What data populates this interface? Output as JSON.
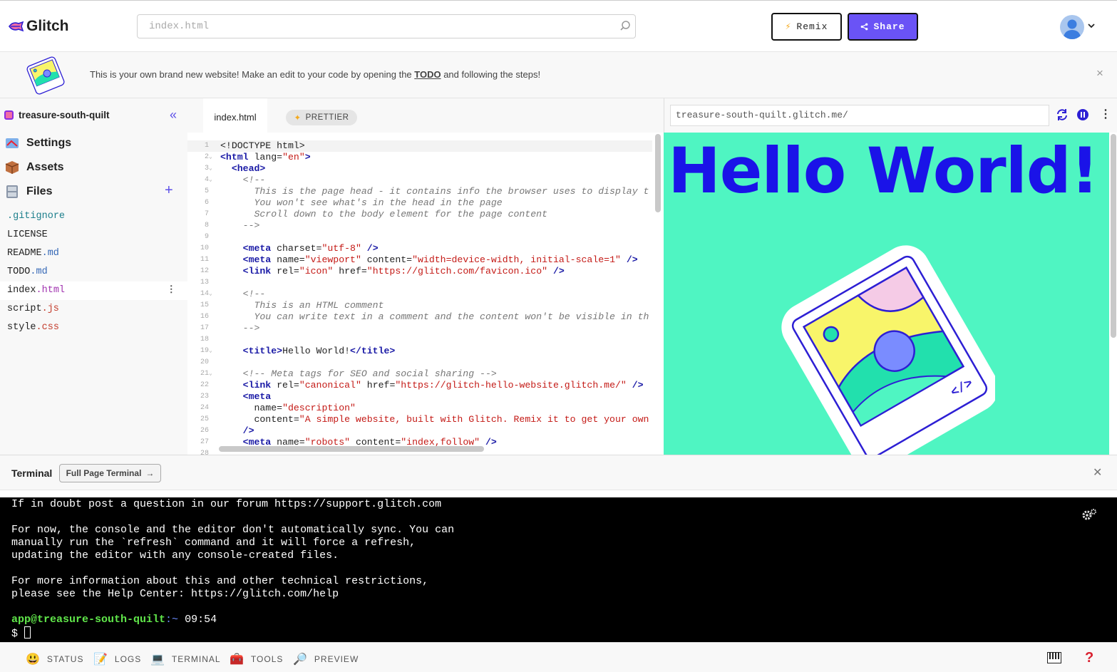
{
  "app": {
    "name": "Glitch"
  },
  "header": {
    "search_value": "index.html",
    "remix_label": "Remix",
    "share_label": "Share"
  },
  "banner": {
    "text_before": "This is your own brand new website! Make an edit to your code by opening the ",
    "link": "TODO",
    "text_after": " and following the steps!",
    "close": "×"
  },
  "sidebar": {
    "project_name": "treasure-south-quilt",
    "items": [
      {
        "label": "Settings",
        "icon": "settings-icon"
      },
      {
        "label": "Assets",
        "icon": "box-icon"
      },
      {
        "label": "Files",
        "icon": "file-cabinet-icon"
      }
    ],
    "files": [
      {
        "base": ".",
        "ext": "gitignore"
      },
      {
        "base": "LICENSE",
        "ext": ""
      },
      {
        "base": "README",
        "ext": ".md"
      },
      {
        "base": "TODO",
        "ext": ".md"
      },
      {
        "base": "index",
        "ext": ".html"
      },
      {
        "base": "script",
        "ext": ".js"
      },
      {
        "base": "style",
        "ext": ".css"
      }
    ]
  },
  "editor": {
    "tab": "index.html",
    "prettier": "PRETTIER"
  },
  "preview": {
    "url": "treasure-south-quilt.glitch.me/",
    "heading": "Hello World!"
  },
  "terminal": {
    "title": "Terminal",
    "full_page": "Full Page Terminal",
    "lines": [
      "If in doubt post a question in our forum https://support.glitch.com",
      "For now, the console and the editor don't automatically sync. You can",
      "manually run the `refresh` command and it will force a refresh,",
      "updating the editor with any console-created files.",
      "For more information about this and other technical restrictions,",
      "please see the Help Center: https://glitch.com/help"
    ],
    "prompt_user": "app@treasure-south-quilt",
    "prompt_path": ":~",
    "prompt_time": " 09:54",
    "prompt_symbol": "$"
  },
  "bottombar": {
    "items": [
      "STATUS",
      "LOGS",
      "TERMINAL",
      "TOOLS",
      "PREVIEW"
    ],
    "help": "?"
  }
}
